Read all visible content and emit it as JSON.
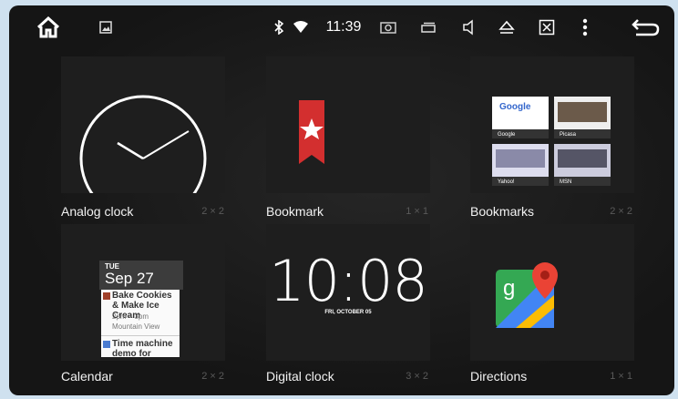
{
  "status": {
    "time": "11:39"
  },
  "widgets": [
    {
      "name": "Analog clock",
      "size": "2 × 2"
    },
    {
      "name": "Bookmark",
      "size": "1 × 1"
    },
    {
      "name": "Bookmarks",
      "size": "2 × 2"
    },
    {
      "name": "Calendar",
      "size": "2 × 2"
    },
    {
      "name": "Digital clock",
      "size": "3 × 2"
    },
    {
      "name": "Directions",
      "size": "1 × 1"
    }
  ],
  "previews": {
    "bookmarks_sites": [
      "Google",
      "Picasa",
      "Yahoo!",
      "MSN"
    ],
    "calendar": {
      "day_of_week": "TUE",
      "date": "Sep 27",
      "events": [
        {
          "title": "Bake Cookies & Make Ice Cream",
          "time": "2pm – 3pm",
          "location": "Mountain View",
          "color": "#a0402a"
        },
        {
          "title": "Time machine demo for Serge",
          "color": "#4a7bd0"
        }
      ]
    },
    "digital_clock": {
      "time": "10:08",
      "date": "FRI, OCTOBER 05"
    }
  },
  "icons": {
    "home": "home-icon",
    "gallery": "image-icon",
    "bluetooth": "bluetooth-icon",
    "wifi": "wifi-icon",
    "screenshot": "camera-icon",
    "window": "window-icon",
    "volume": "volume-icon",
    "eject": "eject-icon",
    "close": "close-box-icon",
    "menu": "more-vert-icon",
    "back": "back-icon"
  },
  "colors": {
    "bookmark_red": "#d32f2f",
    "background": "#1b1b1b"
  }
}
